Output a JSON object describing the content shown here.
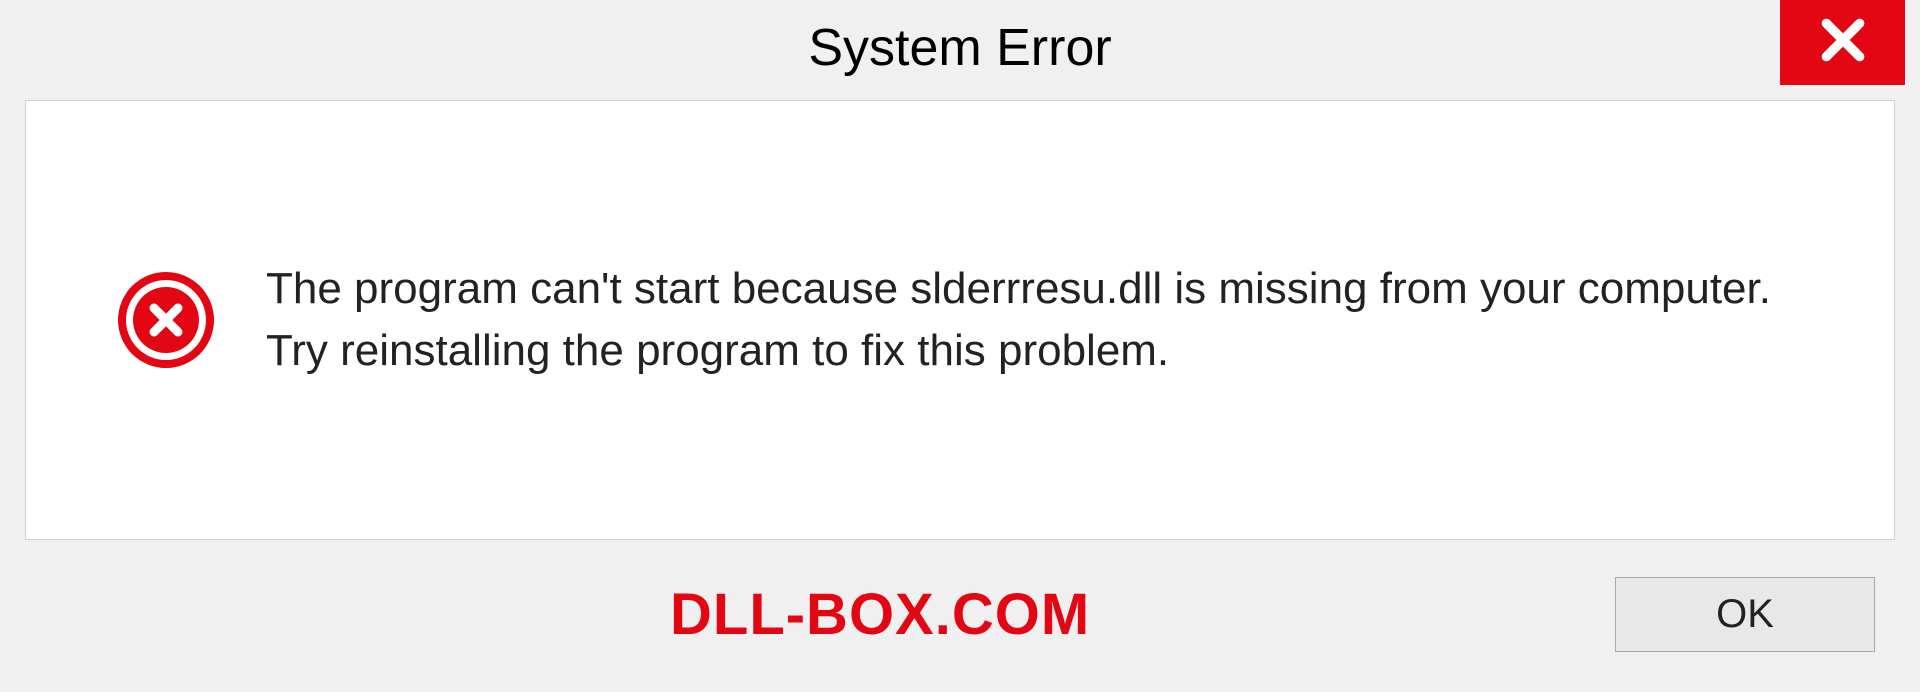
{
  "dialog": {
    "title": "System Error",
    "message": "The program can't start because slderrresu.dll is missing from your computer. Try reinstalling the program to fix this problem.",
    "ok_label": "OK"
  },
  "watermark": "DLL-BOX.COM",
  "colors": {
    "error_red": "#e30613",
    "background": "#f0f0f0",
    "content_bg": "#ffffff"
  }
}
